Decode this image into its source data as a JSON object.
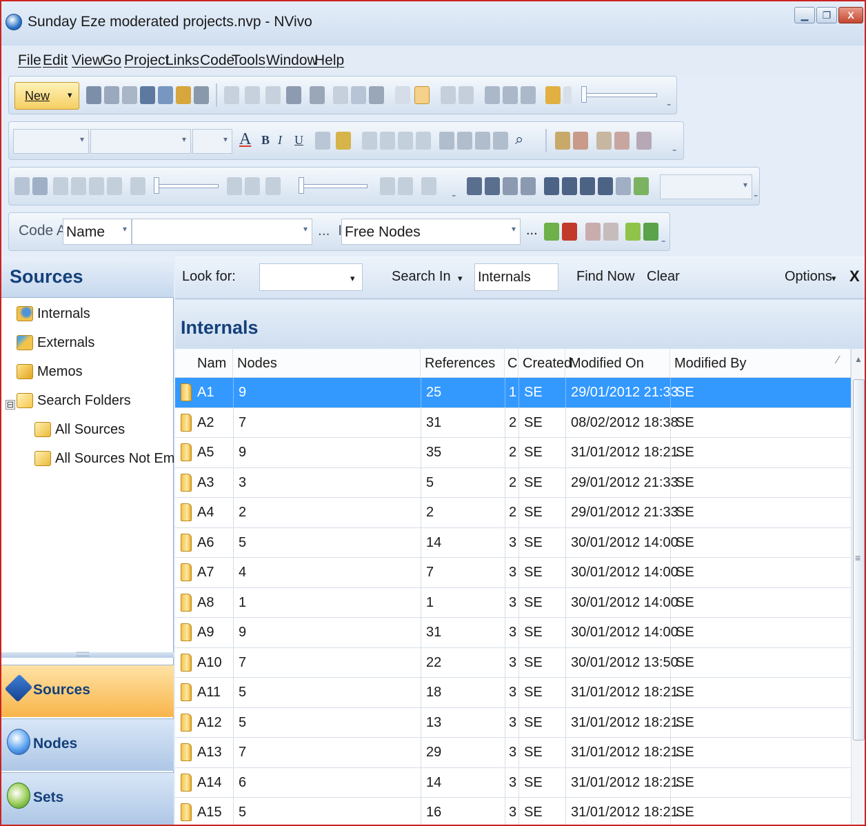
{
  "window": {
    "title": "Sunday Eze moderated projects.nvp - NVivo",
    "min_glyph": "▁",
    "restore_glyph": "❐",
    "close_glyph": "X"
  },
  "menu": [
    "File",
    "Edit",
    "View",
    "Go",
    "Project",
    "Links",
    "Code",
    "Tools",
    "Window",
    "Help"
  ],
  "toolbar": {
    "new_label": "New",
    "dropdown_glyph": "▾",
    "overflow_glyph": "⁼",
    "bold_glyph": "B",
    "italic_glyph": "I",
    "underline_glyph": "U",
    "font_color_glyph": "A",
    "find_glyph": "⌕"
  },
  "code_at": {
    "label": "Code At",
    "select_value": "Name",
    "ellipsis": "...",
    "in_label": "In",
    "in_value": "Free Nodes"
  },
  "nav": {
    "title": "Sources",
    "tree": [
      {
        "label": "Internals",
        "icon": "internals-folder-icon"
      },
      {
        "label": "Externals",
        "icon": "externals-folder-icon"
      },
      {
        "label": "Memos",
        "icon": "memos-folder-icon"
      },
      {
        "label": "Search Folders",
        "icon": "search-folder-icon"
      },
      {
        "label": "All Sources",
        "icon": "search-folder-icon"
      },
      {
        "label": "All Sources Not Embedded",
        "icon": "search-folder-icon"
      }
    ],
    "expander_glyph": "⊟",
    "splitter_grip": "::::::::",
    "buttons": [
      {
        "label": "Sources",
        "icon": "sources-icon",
        "active": true
      },
      {
        "label": "Nodes",
        "icon": "nodes-icon",
        "active": false
      },
      {
        "label": "Sets",
        "icon": "sets-icon",
        "active": false
      }
    ]
  },
  "find": {
    "look_for_label": "Look for:",
    "look_for_value": "",
    "search_in_label": "Search In",
    "search_in_value": "Internals",
    "find_now_label": "Find Now",
    "clear_label": "Clear",
    "options_label": "Options",
    "close_glyph": "X"
  },
  "list": {
    "title": "Internals",
    "columns": [
      "Nam",
      "Nodes",
      "References",
      "C",
      "Created",
      "Modified On",
      "Modified By"
    ],
    "sort_glyph": "⁄",
    "rows": [
      {
        "name": "A1",
        "nodes": "9",
        "references": "25",
        "c": "1",
        "created": "SE",
        "modified_on": "29/01/2012 21:33",
        "modified_by": "SE",
        "selected": true
      },
      {
        "name": "A2",
        "nodes": "7",
        "references": "31",
        "c": "2",
        "created": "SE",
        "modified_on": "08/02/2012 18:38",
        "modified_by": "SE"
      },
      {
        "name": "A5",
        "nodes": "9",
        "references": "35",
        "c": "2",
        "created": "SE",
        "modified_on": "31/01/2012 18:21",
        "modified_by": "SE"
      },
      {
        "name": "A3",
        "nodes": "3",
        "references": "5",
        "c": "2",
        "created": "SE",
        "modified_on": "29/01/2012 21:33",
        "modified_by": "SE"
      },
      {
        "name": "A4",
        "nodes": "2",
        "references": "2",
        "c": "2",
        "created": "SE",
        "modified_on": "29/01/2012 21:33",
        "modified_by": "SE"
      },
      {
        "name": "A6",
        "nodes": "5",
        "references": "14",
        "c": "3",
        "created": "SE",
        "modified_on": "30/01/2012 14:00",
        "modified_by": "SE"
      },
      {
        "name": "A7",
        "nodes": "4",
        "references": "7",
        "c": "3",
        "created": "SE",
        "modified_on": "30/01/2012 14:00",
        "modified_by": "SE"
      },
      {
        "name": "A8",
        "nodes": "1",
        "references": "1",
        "c": "3",
        "created": "SE",
        "modified_on": "30/01/2012 14:00",
        "modified_by": "SE"
      },
      {
        "name": "A9",
        "nodes": "9",
        "references": "31",
        "c": "3",
        "created": "SE",
        "modified_on": "30/01/2012 14:00",
        "modified_by": "SE"
      },
      {
        "name": "A10",
        "nodes": "7",
        "references": "22",
        "c": "3",
        "created": "SE",
        "modified_on": "30/01/2012 13:50",
        "modified_by": "SE"
      },
      {
        "name": "A11",
        "nodes": "5",
        "references": "18",
        "c": "3",
        "created": "SE",
        "modified_on": "31/01/2012 18:21",
        "modified_by": "SE"
      },
      {
        "name": "A12",
        "nodes": "5",
        "references": "13",
        "c": "3",
        "created": "SE",
        "modified_on": "31/01/2012 18:21",
        "modified_by": "SE"
      },
      {
        "name": "A13",
        "nodes": "7",
        "references": "29",
        "c": "3",
        "created": "SE",
        "modified_on": "31/01/2012 18:21",
        "modified_by": "SE"
      },
      {
        "name": "A14",
        "nodes": "6",
        "references": "14",
        "c": "3",
        "created": "SE",
        "modified_on": "31/01/2012 18:21",
        "modified_by": "SE"
      },
      {
        "name": "A15",
        "nodes": "5",
        "references": "16",
        "c": "3",
        "created": "SE",
        "modified_on": "31/01/2012 18:21",
        "modified_by": "SE"
      }
    ]
  },
  "scrollbar": {
    "up_glyph": "▲",
    "grip_glyph": "≡"
  },
  "colors": {
    "window_border": "#cc2222",
    "selection": "#3399ff",
    "header_text": "#14407a",
    "active_nav": "#f8b54a"
  }
}
